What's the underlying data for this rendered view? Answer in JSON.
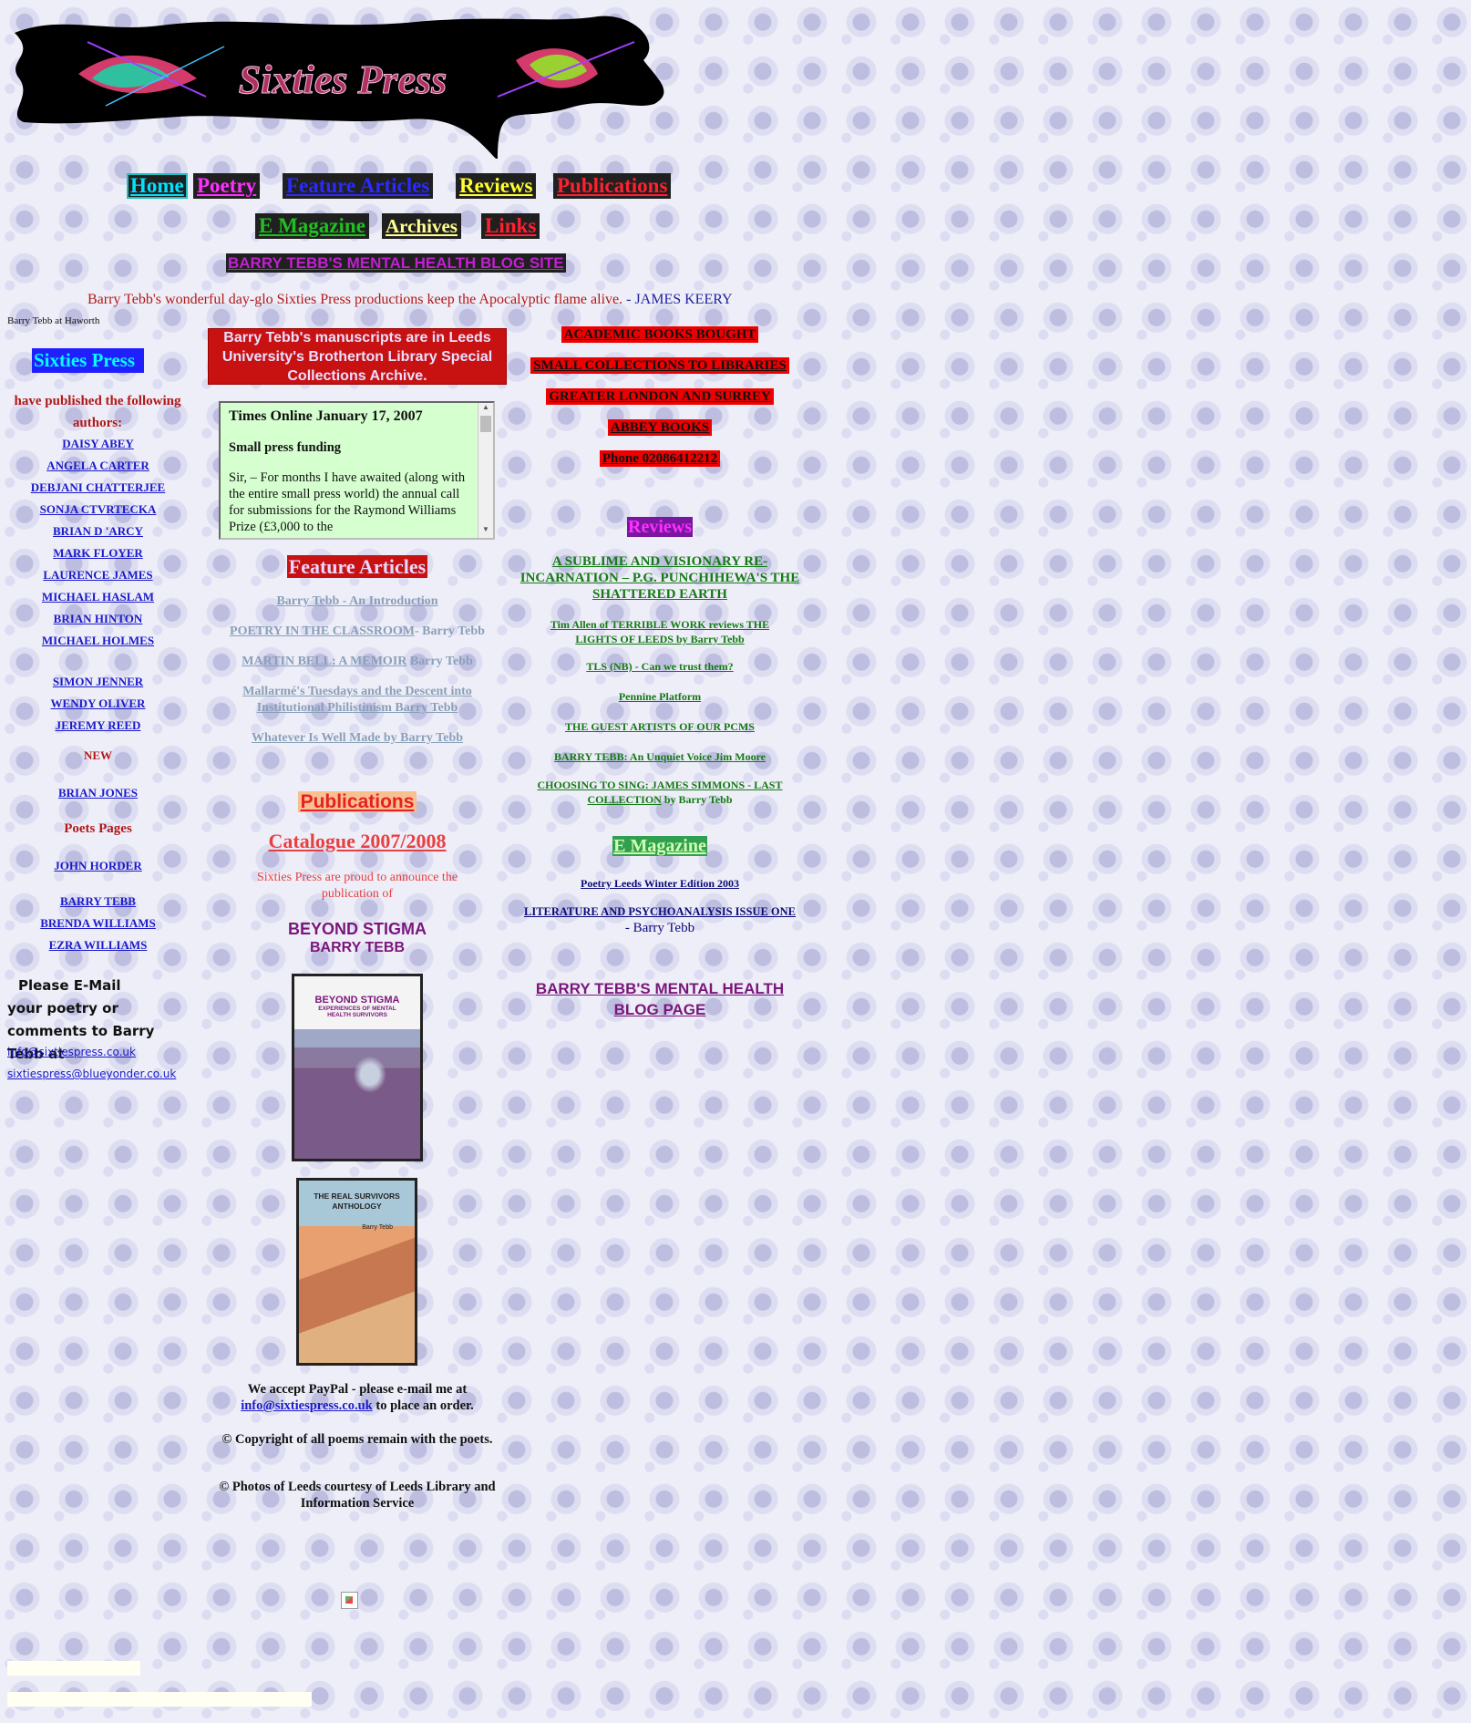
{
  "logo": {
    "title": "Sixties Press"
  },
  "nav": {
    "row1": [
      {
        "label": "Home",
        "bg": "#20c0c0",
        "fg": "#00e0ff"
      },
      {
        "label": "Poetry",
        "bg": "#202020",
        "fg": "#ff30ff"
      },
      {
        "label": "Feature Articles",
        "bg": "#202020",
        "fg": "#2a2aff"
      },
      {
        "label": "Reviews",
        "bg": "#202020",
        "fg": "#ffff30"
      },
      {
        "label": "Publications",
        "bg": "#202020",
        "fg": "#ff2030"
      }
    ],
    "row2": [
      {
        "label": "E Magazine",
        "bg": "#202020",
        "fg": "#20c020"
      },
      {
        "label": "Archives",
        "bg": "#202020",
        "fg": "#ffff90"
      },
      {
        "label": "Links",
        "bg": "#202020",
        "fg": "#ff2030"
      }
    ],
    "blog": "BARRY TEBB'S MENTAL HEALTH BLOG SITE"
  },
  "quote": {
    "text": "Barry Tebb's wonderful day-glo Sixties Press productions keep the Apocalyptic flame alive.",
    "author": " - JAMES KEERY"
  },
  "left": {
    "caption": "Barry Tebb at Haworth",
    "brand": "Sixties Press",
    "intro": "have published the following authors:",
    "authors_a": [
      "DAISY ABEY",
      "ANGELA CARTER",
      "DEBJANI CHATTERJEE",
      "SONJA CTVRTECKA",
      "BRIAN D 'ARCY",
      "MARK FLOYER",
      "LAURENCE JAMES",
      "MICHAEL HASLAM",
      "BRIAN HINTON",
      "MICHAEL HOLMES"
    ],
    "authors_b": [
      "SIMON JENNER",
      "WENDY OLIVER",
      "JEREMY REED"
    ],
    "new_label": "NEW",
    "new_author": "BRIAN JONES",
    "poets_pages": "Poets Pages",
    "poet_c": "JOHN HORDER",
    "authors_d": [
      "BARRY TEBB",
      "BRENDA WILLIAMS",
      "EZRA WILLIAMS"
    ],
    "email_intro": "Please E-Mail your poetry or comments to Barry Tebb at",
    "email1": "info@sixtiespress.co.uk",
    "email2": "sixtiespress@blueyonder.co.uk"
  },
  "middle": {
    "manuscripts": "Barry Tebb's manuscripts are in Leeds University's Brotherton Library Special Collections Archive.",
    "letter": {
      "title": "Times Online January 17, 2007",
      "subtitle": "Small press funding",
      "body": "Sir, – For months I have awaited (along with the entire small press world) the annual call for submissions for the Raymond Williams Prize (£3,000 to the"
    },
    "feature_heading": "Feature Articles",
    "features": [
      {
        "link": "Barry Tebb - An Introduction",
        "suffix": ""
      },
      {
        "link": "POETRY IN THE CLASSROOM",
        "suffix": "- Barry Tebb"
      },
      {
        "link": "MARTIN BELL: A MEMOIR",
        "suffix": " Barry Tebb"
      },
      {
        "link": "Mallarmé's Tuesdays and the Descent into Institutional Philistinism Barry Tebb",
        "suffix": ""
      },
      {
        "link": "Whatever Is Well Made by Barry Tebb",
        "suffix": ""
      }
    ],
    "publications_heading": "Publications",
    "catalogue": "Catalogue 2007/2008",
    "announce": "Sixties Press are proud to announce the publication of",
    "book_title": "BEYOND STIGMA",
    "book_author": "BARRY TEBB",
    "cover1": {
      "title": "BEYOND STIGMA",
      "sub": "EXPERIENCES OF MENTAL HEALTH SURVIVORS"
    },
    "cover2": {
      "title": "THE REAL SURVIVORS ANTHOLOGY",
      "author": "Barry Tebb"
    },
    "paypal_pre": "We accept PayPal - please e-mail me at",
    "paypal_email": "info@sixtiespress.co.uk",
    "paypal_post": " to place an order.",
    "copyright": "© Copyright of all poems remain with the poets.",
    "photos": "© Photos of Leeds courtesy of Leeds Library and Information Service"
  },
  "right": {
    "ads": [
      "ACADEMIC BOOKS BOUGHT",
      "SMALL COLLECTIONS TO LIBRARIES",
      "GREATER LONDON AND SURREY",
      "ABBEY BOOKS",
      "Phone 02086412212"
    ],
    "reviews_heading": "Reviews",
    "review_main": "A SUBLIME AND VISIONARY RE-INCARNATION – P.G. PUNCHIHEWA'S THE SHATTERED EARTH",
    "reviews": [
      "Tim Allen of TERRIBLE WORK reviews THE LIGHTS OF LEEDS by Barry Tebb",
      "TLS (NB) - Can we trust them?",
      "Pennine Platform",
      "THE GUEST ARTISTS OF OUR PCMS",
      "BARRY TEBB: An Unquiet Voice Jim Moore"
    ],
    "review_last_link": "CHOOSING TO SING: JAMES SIMMONS - LAST COLLECTION",
    "review_last_suffix": " by Barry Tebb",
    "emag_heading": "E Magazine",
    "emag1": "Poetry Leeds Winter Edition 2003",
    "emag2": "LITERATURE AND PSYCHOANALYSIS ISSUE ONE",
    "emag2_suffix": " - Barry Tebb",
    "blog_page": "BARRY TEBB'S MENTAL HEALTH BLOG PAGE"
  }
}
